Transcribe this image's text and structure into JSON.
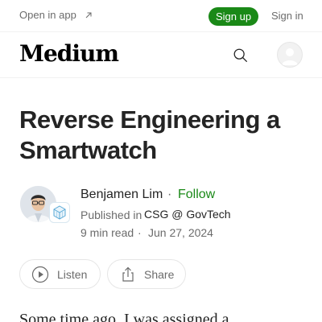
{
  "topbar": {
    "open_in_app": "Open in app",
    "open_in_app_icon": "arrow-up-right-icon",
    "sign_up": "Sign up",
    "sign_in": "Sign in"
  },
  "header": {
    "logo": "Medium",
    "search_icon": "search-icon",
    "avatar_icon": "user-avatar-icon"
  },
  "article": {
    "title": "Reverse Engineering a Smartwatch",
    "author": {
      "name": "Benjamen Lim",
      "follow": "Follow",
      "separator": "·"
    },
    "publication": {
      "prefix": "Published in",
      "name": "CSG @ GovTech"
    },
    "meta": {
      "read_time": "9 min read",
      "separator": "·",
      "date": "Jun 27, 2024"
    },
    "actions": {
      "listen": "Listen",
      "listen_icon": "play-circle-icon",
      "share": "Share",
      "share_icon": "share-icon"
    },
    "body_preview": "Some time ago, I was assigned a"
  },
  "colors": {
    "accent_green": "#1a8917",
    "text_primary": "#242424",
    "text_secondary": "#6b6b6b",
    "border": "#e6e6e6"
  }
}
